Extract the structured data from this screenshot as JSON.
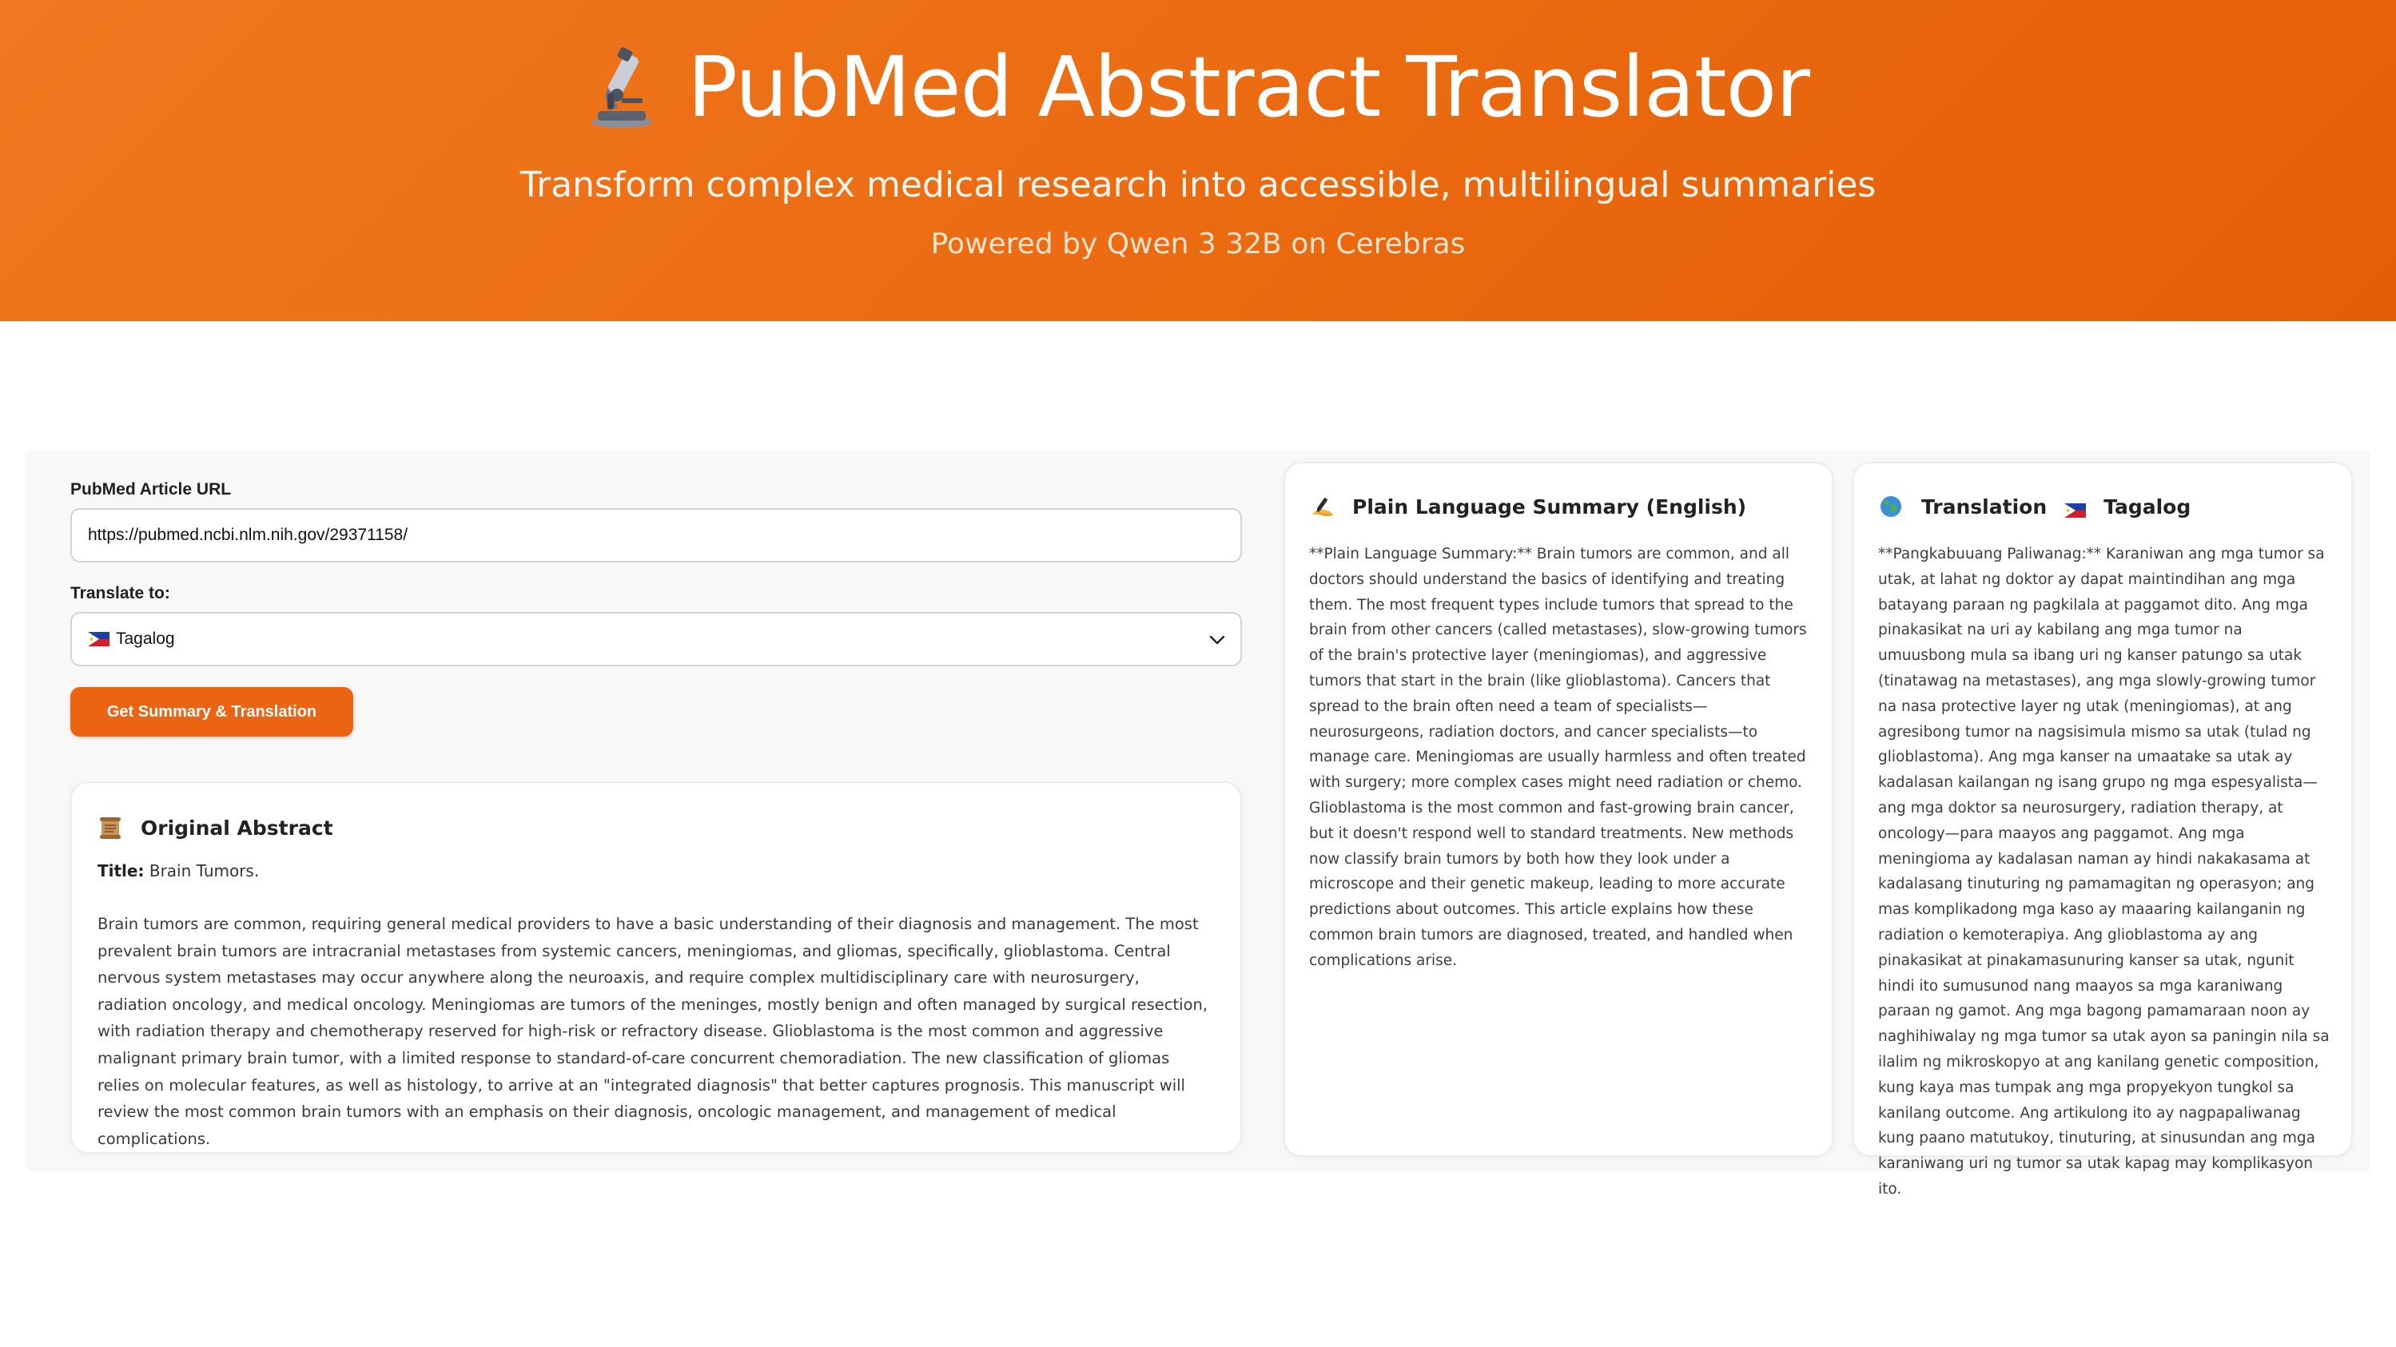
{
  "header": {
    "title": "PubMed Abstract Translator",
    "subtitle": "Transform complex medical research into accessible, multilingual summaries",
    "powered_by": "Powered by Qwen 3 32B on Cerebras",
    "title_icon": "microscope-icon"
  },
  "colors": {
    "header_bg": "#ef7020",
    "accent": "#ea6414",
    "panel_bg": "#f8f8f7",
    "card_bg": "#ffffff"
  },
  "form": {
    "url_label": "PubMed Article URL",
    "url_value": "https://pubmed.ncbi.nlm.nih.gov/29371158/",
    "language_label": "Translate to:",
    "language_value": "Tagalog",
    "language_flag": "philippines-flag-icon",
    "submit_label": "Get Summary & Translation"
  },
  "original": {
    "heading": "Original Abstract",
    "icon": "scroll-icon",
    "title_label": "Title:",
    "title_value": "Brain Tumors.",
    "body": "Brain tumors are common, requiring general medical providers to have a basic understanding of their diagnosis and management. The most prevalent brain tumors are intracranial metastases from systemic cancers, meningiomas, and gliomas, specifically, glioblastoma. Central nervous system metastases may occur anywhere along the neuroaxis, and require complex multidisciplinary care with neurosurgery, radiation oncology, and medical oncology. Meningiomas are tumors of the meninges, mostly benign and often managed by surgical resection, with radiation therapy and chemotherapy reserved for high-risk or refractory disease. Glioblastoma is the most common and aggressive malignant primary brain tumor, with a limited response to standard-of-care concurrent chemoradiation. The new classification of gliomas relies on molecular features, as well as histology, to arrive at an \"integrated diagnosis\" that better captures prognosis. This manuscript will review the most common brain tumors with an emphasis on their diagnosis, oncologic management, and management of medical complications."
  },
  "summary": {
    "heading": "Plain Language Summary (English)",
    "icon": "writing-hand-icon",
    "body": "**Plain Language Summary:** Brain tumors are common, and all doctors should understand the basics of identifying and treating them. The most frequent types include tumors that spread to the brain from other cancers (called metastases), slow-growing tumors of the brain's protective layer (meningiomas), and aggressive tumors that start in the brain (like glioblastoma). Cancers that spread to the brain often need a team of specialists—neurosurgeons, radiation doctors, and cancer specialists—to manage care. Meningiomas are usually harmless and often treated with surgery; more complex cases might need radiation or chemo. Glioblastoma is the most common and fast-growing brain cancer, but it doesn't respond well to standard treatments. New methods now classify brain tumors by both how they look under a microscope and their genetic makeup, leading to more accurate predictions about outcomes. This article explains how these common brain tumors are diagnosed, treated, and handled when complications arise."
  },
  "translation": {
    "heading": "Translation",
    "language": "Tagalog",
    "icon": "globe-icon",
    "flag": "philippines-flag-icon",
    "body": "**Pangkabuuang Paliwanag:** Karaniwan ang mga tumor sa utak, at lahat ng doktor ay dapat maintindihan ang mga batayang paraan ng pagkilala at paggamot dito. Ang mga pinakasikat na uri ay kabilang ang mga tumor na umuusbong mula sa ibang uri ng kanser patungo sa utak (tinatawag na metastases), ang mga slowly-growing tumor na nasa protective layer ng utak (meningiomas), at ang agresibong tumor na nagsisimula mismo sa utak (tulad ng glioblastoma). Ang mga kanser na umaatake sa utak ay kadalasan kailangan ng isang grupo ng mga espesyalista—ang mga doktor sa neurosurgery, radiation therapy, at oncology—para maayos ang paggamot. Ang mga meningioma ay kadalasan naman ay hindi nakakasama at kadalasang tinuturing ng pamamagitan ng operasyon; ang mas komplikadong mga kaso ay maaaring kailanganin ng radiation o kemoterapiya. Ang glioblastoma ay ang pinakasikat at pinakamasunuring kanser sa utak, ngunit hindi ito sumusunod nang maayos sa mga karaniwang paraan ng gamot. Ang mga bagong pamamaraan noon ay naghihiwalay ng mga tumor sa utak ayon sa paningin nila sa ilalim ng mikroskopyo at ang kanilang genetic composition, kung kaya mas tumpak ang mga propyekyon tungkol sa kanilang outcome. Ang artikulong ito ay nagpapaliwanag kung paano matutukoy, tinuturing, at sinusundan ang mga karaniwang uri ng tumor sa utak kapag may komplikasyon ito."
  }
}
